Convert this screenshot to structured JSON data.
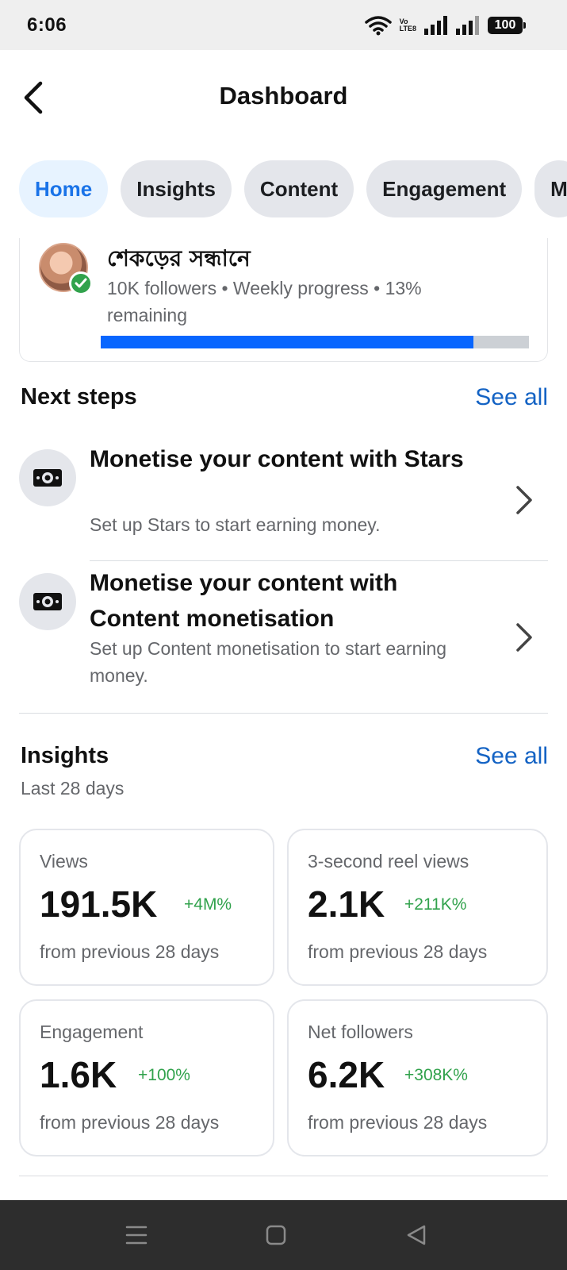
{
  "status_bar": {
    "time": "6:06",
    "volte_top": "Vo",
    "volte_bottom": "LTE8",
    "battery": "100"
  },
  "header": {
    "title": "Dashboard"
  },
  "tabs": [
    {
      "label": "Home",
      "active": true
    },
    {
      "label": "Insights",
      "active": false
    },
    {
      "label": "Content",
      "active": false
    },
    {
      "label": "Engagement",
      "active": false
    },
    {
      "label": "M",
      "active": false
    }
  ],
  "profile": {
    "name": "শেকড়ের সন্ধানে",
    "meta": "10K followers • Weekly progress • 13% remaining",
    "progress_fraction": 0.87
  },
  "next_steps": {
    "title": "Next steps",
    "see_all": "See all",
    "items": [
      {
        "title": "Monetise your content with Stars",
        "desc": "Set up Stars to start earning money."
      },
      {
        "title": "Monetise your content with Content monetisation",
        "desc": "Set up Content monetisation to start earning money."
      }
    ]
  },
  "insights": {
    "title": "Insights",
    "see_all": "See all",
    "period": "Last 28 days",
    "cards": [
      {
        "label": "Views",
        "value": "191.5K",
        "change": "+4M%",
        "foot": "from previous 28 days"
      },
      {
        "label": "3-second reel views",
        "value": "2.1K",
        "change": "+211K%",
        "foot": "from previous 28 days"
      },
      {
        "label": "Engagement",
        "value": "1.6K",
        "change": "+100%",
        "foot": "from previous 28 days"
      },
      {
        "label": "Net followers",
        "value": "6.2K",
        "change": "+308K%",
        "foot": "from previous 28 days"
      }
    ]
  },
  "colors": {
    "accent": "#1463c4",
    "progress": "#0866ff",
    "positive": "#31a24c"
  }
}
